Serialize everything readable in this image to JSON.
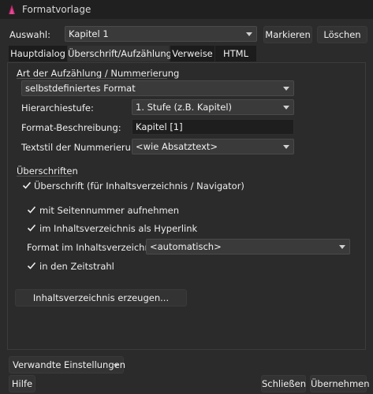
{
  "window": {
    "title": "Formatvorlage"
  },
  "top": {
    "selection_label": "Auswahl:",
    "selection_value": "Kapitel 1",
    "mark_button": "Markieren",
    "delete_button": "Löschen"
  },
  "tabs": [
    {
      "label": "Hauptdialog"
    },
    {
      "label": "Überschrift/Aufzählung"
    },
    {
      "label": "Verweise"
    },
    {
      "label": "HTML"
    }
  ],
  "numbering": {
    "section_title": "Art der Aufzählung / Nummerierung",
    "type_value": "selbstdefiniertes Format",
    "level_label": "Hierarchiestufe:",
    "level_value": "1. Stufe (z.B. Kapitel)",
    "format_label": "Format-Beschreibung:",
    "format_value": "Kapitel [1]",
    "textstyle_label": "Textstil der Nummerierung:",
    "textstyle_value": "<wie Absatztext>"
  },
  "headings": {
    "section_title": "Überschriften",
    "check_toc": "Überschrift (für Inhaltsverzeichnis / Navigator)",
    "check_pagenum": "mit Seitennummer aufnehmen",
    "check_hyperlink": "im Inhaltsverzeichnis als Hyperlink",
    "toc_format_label": "Format im Inhaltsverzeichnis:",
    "toc_format_value": "<automatisch>",
    "check_timeline": "in den Zeitstrahl",
    "generate_button": "Inhaltsverzeichnis erzeugen..."
  },
  "footer": {
    "related_settings": "Verwandte Einstellungen",
    "help": "Hilfe",
    "close": "Schließen",
    "apply": "Übernehmen"
  },
  "colors": {
    "background": "#2b2b2b",
    "titlebar": "#202020",
    "accent_icon": "#c0266d"
  },
  "icons": [
    "app-logo-icon",
    "chevron-down-icon",
    "checkmark-icon"
  ]
}
